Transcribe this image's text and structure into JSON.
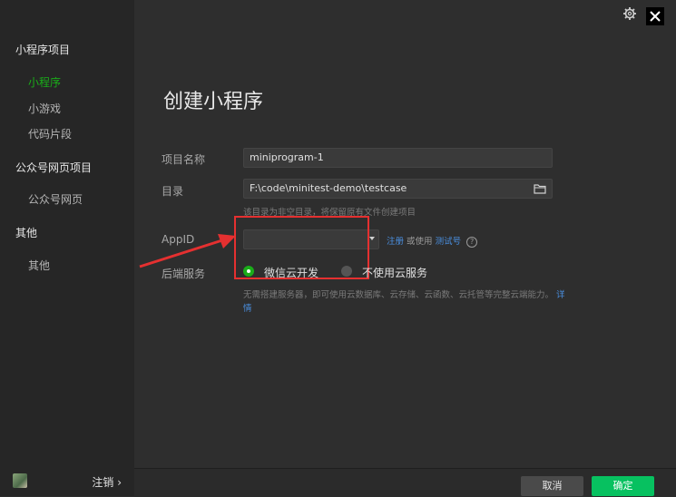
{
  "sidebar": {
    "section1": "小程序项目",
    "items1": [
      "小程序",
      "小游戏",
      "代码片段"
    ],
    "section2": "公众号网页项目",
    "items2": [
      "公众号网页"
    ],
    "section3": "其他",
    "items3": [
      "其他"
    ],
    "logout": "注销 ›"
  },
  "main": {
    "title": "创建小程序",
    "project_name_label": "项目名称",
    "project_name_value": "miniprogram-1",
    "dir_label": "目录",
    "dir_value": "F:\\code\\minitest-demo\\testcase",
    "dir_hint": "该目录为非空目录，将保留原有文件创建项目",
    "appid_label": "AppID",
    "appid_value": "",
    "appid_register": "注册",
    "appid_or": "或使用",
    "appid_test": "测试号",
    "backend_label": "后端服务",
    "radio_on": "微信云开发",
    "radio_off": "不使用云服务",
    "backend_desc": "无需搭建服务器，即可使用云数据库、云存储、云函数、云托管等完整云端能力。",
    "backend_desc_link": "详情"
  },
  "buttons": {
    "cancel": "取消",
    "ok": "确定"
  },
  "colors": {
    "accent": "#1aad19",
    "ok_button": "#07c160",
    "highlight": "#e53030",
    "link": "#4a90e2"
  }
}
